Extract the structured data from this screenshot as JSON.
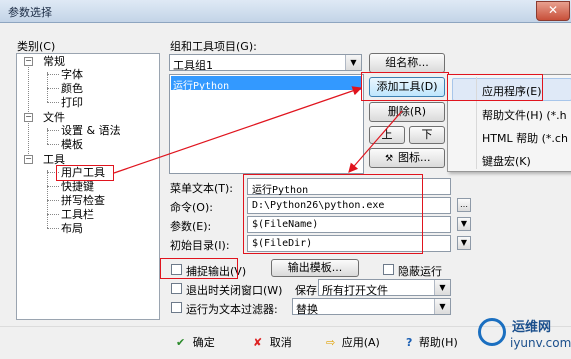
{
  "window": {
    "title": "参数选择",
    "close_glyph": "✕"
  },
  "category": {
    "label": "类别(C)",
    "tree": [
      {
        "label": "常规",
        "children": [
          "字体",
          "颜色",
          "打印"
        ]
      },
      {
        "label": "文件",
        "children": [
          "设置 & 语法",
          "模板"
        ]
      },
      {
        "label": "工具",
        "children": [
          "用户工具",
          "快捷键",
          "拼写检查",
          "工具栏",
          "布局"
        ]
      }
    ],
    "expander_glyph": "−"
  },
  "groups": {
    "label": "组和工具项目(G):",
    "selected_group": "工具组1",
    "group_name_button": "组名称...",
    "items": [
      "运行Python"
    ],
    "add_tool_button": "添加工具(D)",
    "delete_button": "删除(R)",
    "up_button": "上",
    "down_button": "下",
    "icon_button": "图标..."
  },
  "add_tool_menu": {
    "items": [
      "应用程序(E)",
      "帮助文件(H) (*.h",
      "HTML 帮助 (*.ch",
      "键盘宏(K)"
    ]
  },
  "fields": {
    "menu_text_label": "菜单文本(T):",
    "menu_text_value": "运行Python",
    "command_label": "命令(O):",
    "command_value": "D:\\Python26\\python.exe",
    "params_label": "参数(E):",
    "params_value": "$(FileName)",
    "init_dir_label": "初始目录(I):",
    "init_dir_value": "$(FileDir)"
  },
  "options": {
    "capture_output": "捕捉输出(V)",
    "output_template_button": "输出模板...",
    "hide_run": "隐蔽运行",
    "close_on_exit": "退出时关闭窗口(W)",
    "save_label": "保存:",
    "save_value": "所有打开文件",
    "run_as_filter": "运行为文本过滤器:",
    "filter_value": "替换"
  },
  "buttons": {
    "ok": "确定",
    "cancel": "取消",
    "apply": "应用(A)",
    "help": "帮助(H)"
  },
  "watermark": {
    "cn": "运维网",
    "url": "iyunv.com"
  },
  "colors": {
    "annotation_red": "#e0141e",
    "selection_blue": "#3399ff"
  }
}
